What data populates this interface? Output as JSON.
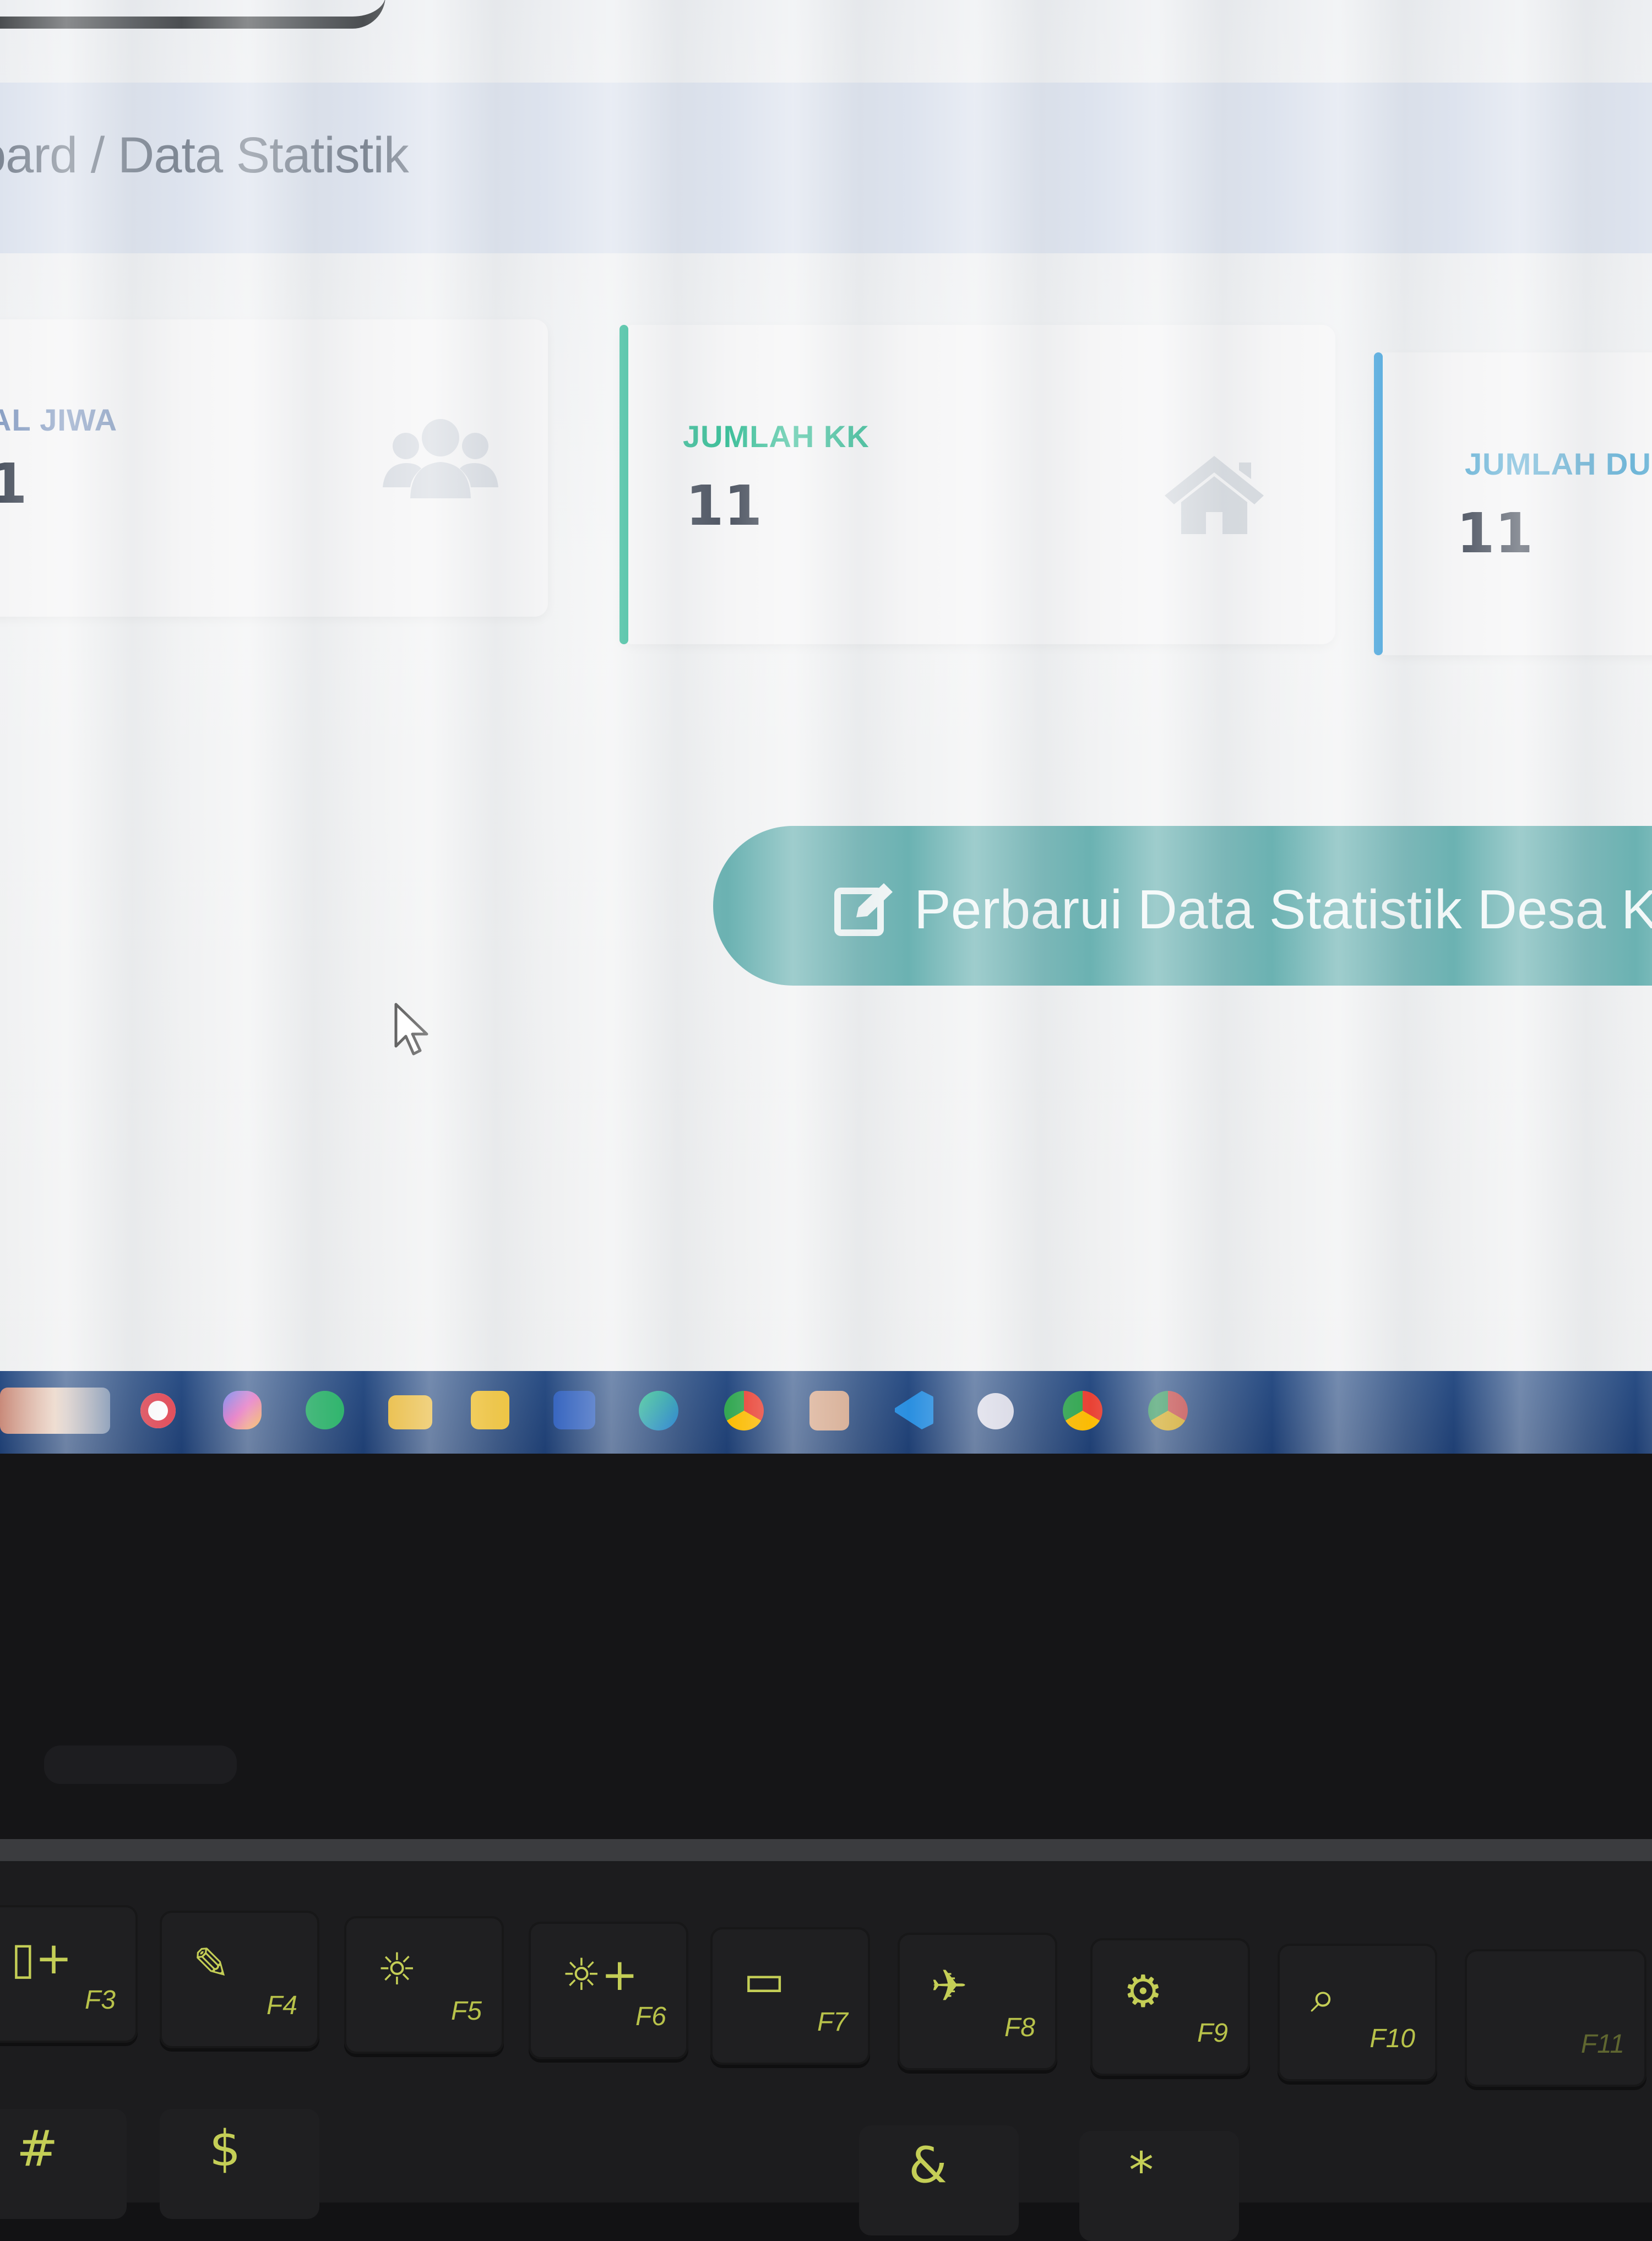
{
  "breadcrumb": {
    "text": "oard / Data Statistik"
  },
  "cards": [
    {
      "label": "AL JIWA",
      "value": "1",
      "color": "#3f78c9"
    },
    {
      "label": "JUMLAH KK",
      "value": "11",
      "color": "#1db28d"
    },
    {
      "label": "JUMLAH DU",
      "value": "11",
      "color": "#3aa0dd"
    }
  ],
  "update_button": {
    "label": "Perbarui Data Statistik Desa Ka"
  },
  "function_keys": [
    "F3",
    "F4",
    "F5",
    "F6",
    "F7",
    "F8",
    "F9",
    "F10",
    "F11"
  ],
  "bottom_keys": [
    "#",
    "$",
    "&",
    "*"
  ],
  "colors": {
    "accent_teal": "#6bb2b2",
    "breadcrumb_bg": "#dde3ee",
    "taskbar": "#234781"
  }
}
